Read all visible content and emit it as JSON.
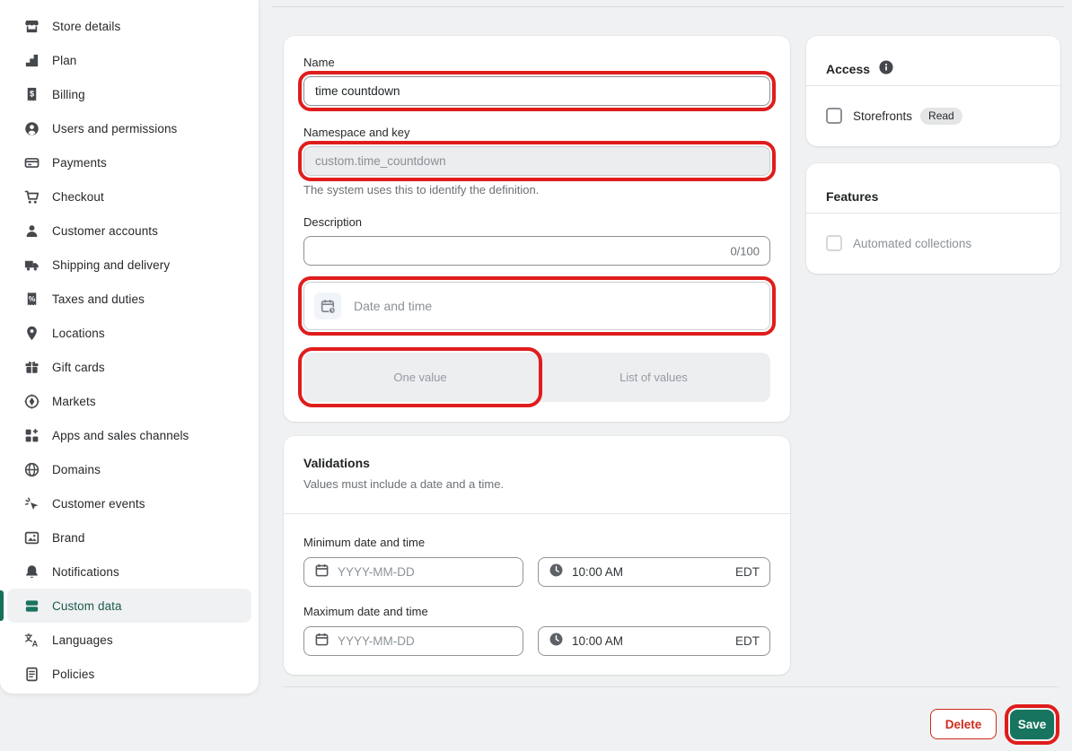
{
  "sidebar": {
    "items": [
      {
        "label": "Store details",
        "icon": "store-icon"
      },
      {
        "label": "Plan",
        "icon": "plan-icon"
      },
      {
        "label": "Billing",
        "icon": "billing-icon"
      },
      {
        "label": "Users and permissions",
        "icon": "users-icon"
      },
      {
        "label": "Payments",
        "icon": "payments-icon"
      },
      {
        "label": "Checkout",
        "icon": "checkout-icon"
      },
      {
        "label": "Customer accounts",
        "icon": "customer-accounts-icon"
      },
      {
        "label": "Shipping and delivery",
        "icon": "shipping-icon"
      },
      {
        "label": "Taxes and duties",
        "icon": "taxes-icon"
      },
      {
        "label": "Locations",
        "icon": "locations-icon"
      },
      {
        "label": "Gift cards",
        "icon": "gift-cards-icon"
      },
      {
        "label": "Markets",
        "icon": "markets-icon"
      },
      {
        "label": "Apps and sales channels",
        "icon": "apps-icon"
      },
      {
        "label": "Domains",
        "icon": "domains-icon"
      },
      {
        "label": "Customer events",
        "icon": "customer-events-icon"
      },
      {
        "label": "Brand",
        "icon": "brand-icon"
      },
      {
        "label": "Notifications",
        "icon": "notifications-icon"
      },
      {
        "label": "Custom data",
        "icon": "custom-data-icon",
        "selected": true
      },
      {
        "label": "Languages",
        "icon": "languages-icon"
      },
      {
        "label": "Policies",
        "icon": "policies-icon"
      }
    ]
  },
  "main": {
    "definition_card": {
      "name_label": "Name",
      "name_value": "time countdown",
      "namespace_label": "Namespace and key",
      "namespace_value": "custom.time_countdown",
      "namespace_help": "The system uses this to identify the definition.",
      "description_label": "Description",
      "description_value": "",
      "description_counter": "0/100",
      "type_selector": {
        "label": "Date and time",
        "icon": "calendar-clock-icon"
      },
      "segmented": {
        "one_value": "One value",
        "list_of_values": "List of values"
      }
    },
    "validations_card": {
      "title": "Validations",
      "subtitle": "Values must include a date and a time.",
      "min_label": "Minimum date and time",
      "max_label": "Maximum date and time",
      "date_placeholder": "YYYY-MM-DD",
      "time_value": "10:00 AM",
      "timezone": "EDT"
    },
    "footer": {
      "delete_label": "Delete",
      "save_label": "Save"
    }
  },
  "aside": {
    "access_card": {
      "title": "Access",
      "storefronts_label": "Storefronts",
      "read_badge": "Read",
      "storefronts_checked": false
    },
    "features_card": {
      "title": "Features",
      "automated_collections_label": "Automated collections",
      "automated_collections_checked": false
    }
  },
  "colors": {
    "accent_green": "#17745e",
    "selected_text_green": "#1a5a4e",
    "highlight_red": "#df1d1c",
    "destructive_red": "#cf2a1d",
    "page_bg": "#f0f1f2"
  }
}
